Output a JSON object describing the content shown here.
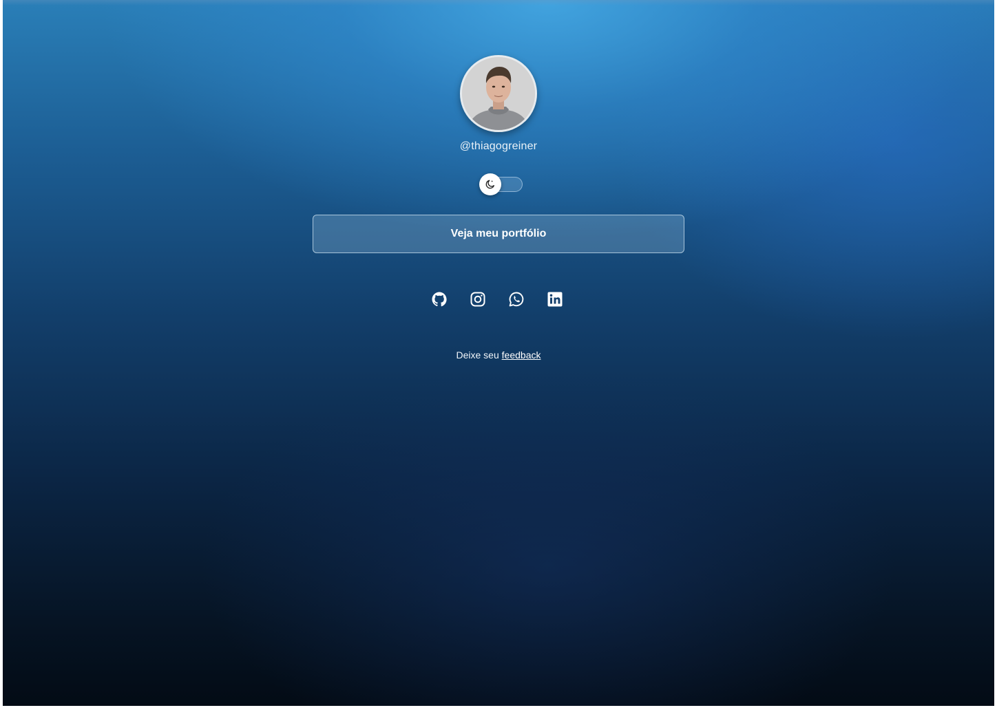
{
  "profile": {
    "username": "@thiagogreiner",
    "avatar_icon": "profile-photo"
  },
  "theme_toggle": {
    "icon": "moon-icon",
    "state": "off"
  },
  "portfolio_button": {
    "label": "Veja meu portfólio"
  },
  "social_links": [
    {
      "icon": "github-icon"
    },
    {
      "icon": "instagram-icon"
    },
    {
      "icon": "whatsapp-icon"
    },
    {
      "icon": "linkedin-icon"
    }
  ],
  "feedback": {
    "prefix": "Deixe seu",
    "link_label": "feedback"
  },
  "colors": {
    "background_top": "#2a7fb8",
    "background_bottom": "#030b15",
    "text": "#ffffff"
  }
}
